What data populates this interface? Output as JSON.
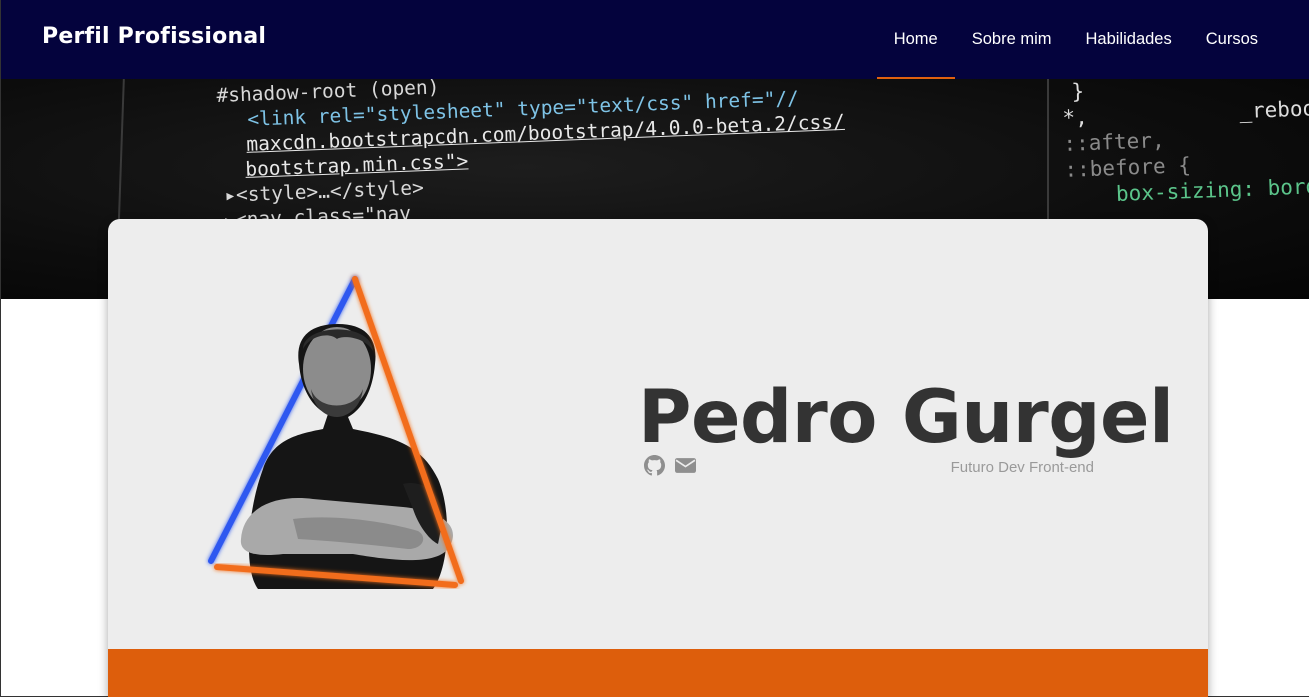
{
  "navbar": {
    "brand": "Perfil Profissional",
    "items": [
      {
        "label": "Home",
        "active": true
      },
      {
        "label": "Sobre mim",
        "active": false
      },
      {
        "label": "Habilidades",
        "active": false
      },
      {
        "label": "Cursos",
        "active": false
      }
    ],
    "accent_color": "#e0610f",
    "background_color": "#04033d"
  },
  "hero": {
    "code_lines": [
      "#shadow-root (open)",
      "<link rel=\"stylesheet\" type=\"text/css\" href=\"//",
      "maxcdn.bootstrapcdn.com/bootstrap/4.0.0-beta.2/css/",
      "bootstrap.min.css\">",
      "▸<style>…</style>",
      "▸<nav class=\"nav"
    ],
    "code_right_lines": [
      "}",
      "*,            _reboot.",
      "::after,",
      "::before {",
      "    box-sizing: bord"
    ]
  },
  "profile": {
    "name": "Pedro Gurgel",
    "tagline": "Futuro Dev Front-end",
    "social_icons": [
      "github-icon",
      "envelope-icon"
    ],
    "footer_color": "#dd5e0c"
  }
}
